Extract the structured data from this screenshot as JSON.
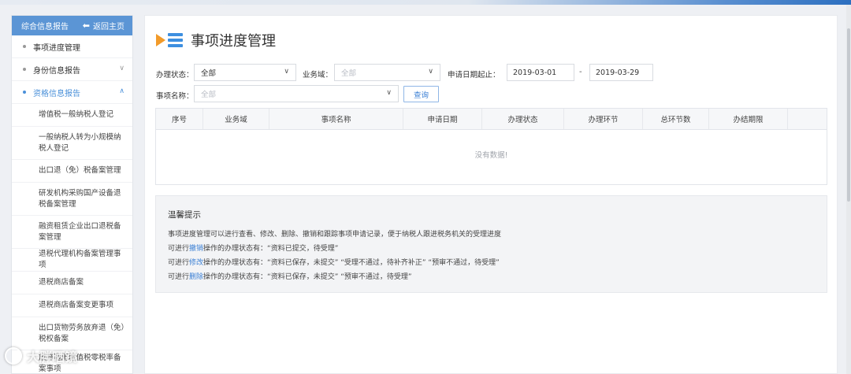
{
  "sidebar": {
    "header_title": "综合信息报告",
    "back_label": "返回主页",
    "items": [
      {
        "label": "事项进度管理"
      },
      {
        "label": "身份信息报告"
      },
      {
        "label": "资格信息报告"
      }
    ],
    "sub_items": [
      "增值税一般纳税人登记",
      "一般纳税人转为小规模纳税人登记",
      "出口退（免）税备案管理",
      "研发机构采购国产设备退税备案管理",
      "融资租赁企业出口退税备案管理",
      "退税代理机构备案管理事项",
      "退税商店备案",
      "退税商店备案变更事项",
      "出口货物劳务放弃退（免）税权备案",
      "放弃适用增值税零税率备案事项"
    ]
  },
  "main": {
    "title": "事项进度管理",
    "filters": {
      "status_label": "办理状态：",
      "status_value": "全部",
      "domain_label": "业务域：",
      "domain_value": "全部",
      "date_label": "申请日期起止：",
      "date_from": "2019-03-01",
      "date_sep": "-",
      "date_to": "2019-03-29",
      "item_label": "事项名称：",
      "item_value": "全部",
      "query_button": "查询"
    },
    "table": {
      "columns": [
        "序号",
        "业务域",
        "事项名称",
        "申请日期",
        "办理状态",
        "办理环节",
        "总环节数",
        "办结期限"
      ],
      "empty_text": "没有数据!"
    },
    "tips": {
      "title": "温馨提示",
      "line1": "事项进度管理可以进行查看、修改、删除、撤销和跟踪事项申请记录，便于纳税人跟进税务机关的受理进度",
      "line2_pre": "可进行",
      "line2_link": "撤销",
      "line2_post": "操作的办理状态有：“资料已提交，待受理”",
      "line3_pre": "可进行",
      "line3_link": "修改",
      "line3_post": "操作的办理状态有：“资料已保存，未提交”  “受理不通过，待补齐补正”  “预审不通过，待受理”",
      "line4_pre": "可进行",
      "line4_link": "删除",
      "line4_post": "操作的办理状态有：“资料已保存，未提交”  “预审不通过，待受理”"
    }
  },
  "watermark": "大胖晒镜",
  "colors": {
    "accent": "#4a90d9",
    "sidebar_header": "#5b95d5",
    "title_icon_orange": "#f29b2a",
    "title_icon_blue": "#3d8fe0"
  }
}
